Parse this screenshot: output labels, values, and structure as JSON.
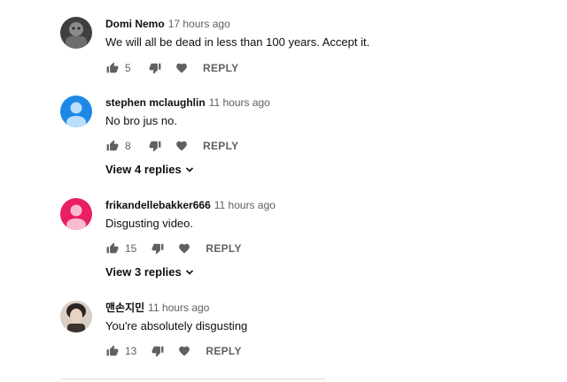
{
  "comments": [
    {
      "author": "Domi Nemo",
      "time": "17 hours ago",
      "text": "We will all be dead in less than 100 years. Accept it.",
      "likes": "5",
      "reply_label": "REPLY",
      "avatar_color": "#5a5a5a"
    },
    {
      "author": "stephen mclaughlin",
      "time": "11 hours ago",
      "text": "No bro jus no.",
      "likes": "8",
      "reply_label": "REPLY",
      "avatar_color": "#1e88e5",
      "view_replies": "View 4 replies"
    },
    {
      "author": "frikandellebakker666",
      "time": "11 hours ago",
      "text": "Disgusting video.",
      "likes": "15",
      "reply_label": "REPLY",
      "avatar_color": "#e91e63",
      "view_replies": "View 3 replies"
    },
    {
      "author": "맨손지민",
      "time": "11 hours ago",
      "text": "You're absolutely disgusting",
      "likes": "13",
      "reply_label": "REPLY",
      "avatar_color": "#8d7a6a"
    }
  ],
  "icons": {
    "like": "thumb-up-icon",
    "dislike": "thumb-down-icon",
    "heart": "heart-icon",
    "chevron": "chevron-down-icon"
  }
}
